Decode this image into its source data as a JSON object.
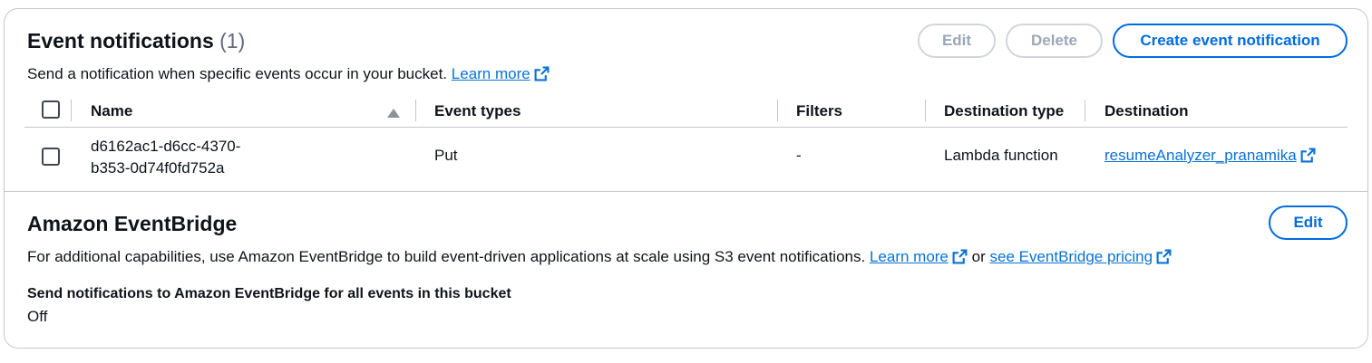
{
  "event_notifications": {
    "title": "Event notifications",
    "count": "(1)",
    "description": "Send a notification when specific events occur in your bucket.",
    "learn_more": "Learn more",
    "buttons": {
      "edit": "Edit",
      "delete": "Delete",
      "create": "Create event notification"
    },
    "columns": [
      "Name",
      "Event types",
      "Filters",
      "Destination type",
      "Destination"
    ],
    "sort_icon": "caret-up-icon",
    "rows": [
      {
        "name_line1": "d6162ac1-d6cc-4370-",
        "name_line2": "b353-0d74f0fd752a",
        "event_types": "Put",
        "filters": "-",
        "destination_type": "Lambda function",
        "destination": "resumeAnalyzer_pranamika"
      }
    ]
  },
  "eventbridge": {
    "title": "Amazon EventBridge",
    "edit": "Edit",
    "description": "For additional capabilities, use Amazon EventBridge to build event-driven applications at scale using S3 event notifications.",
    "learn_more": "Learn more",
    "or": "or",
    "pricing_link": "see EventBridge pricing",
    "setting_label": "Send notifications to Amazon EventBridge for all events in this bucket",
    "setting_value": "Off"
  },
  "colors": {
    "link": "#0972d3",
    "primary": "#006ce0",
    "border": "#c6c6cd",
    "disabled": "#9ba7b6"
  },
  "icons": {
    "external": "external-link-icon",
    "checkbox": "checkbox-icon"
  }
}
